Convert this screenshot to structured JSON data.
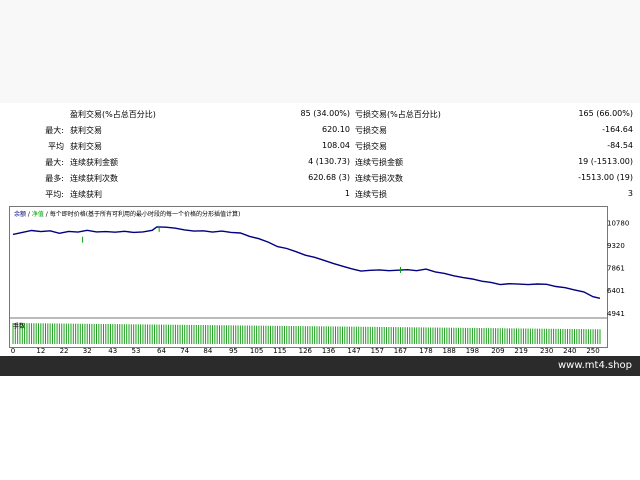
{
  "report": {
    "rows": [
      {
        "left_label": "",
        "left_value": "盈利交易(%占总百分比)",
        "left_num": "85 (34.00%)",
        "right_value": "亏损交易(%占总百分比)",
        "right_num": "165 (66.00%)"
      },
      {
        "left_label": "最大:",
        "left_value": "获利交易",
        "left_num": "620.10",
        "right_value": "亏损交易",
        "right_num": "-164.64"
      },
      {
        "left_label": "平均",
        "left_value": "获利交易",
        "left_num": "108.04",
        "right_value": "亏损交易",
        "right_num": "-84.54"
      },
      {
        "left_label": "最大:",
        "left_value": "连续获利金额",
        "left_num": "4 (130.73)",
        "right_value": "连续亏损金额",
        "right_num": "19 (-1513.00)"
      },
      {
        "left_label": "最多:",
        "left_value": "连续获利次数",
        "left_num": "620.68 (3)",
        "right_value": "连续亏损次数",
        "right_num": "-1513.00 (19)"
      },
      {
        "left_label": "平均:",
        "left_value": "连续获利",
        "left_num": "1",
        "right_value": "连续亏损",
        "right_num": "3"
      }
    ]
  },
  "chart": {
    "legend_balance": "余额",
    "legend_sep": " / ",
    "legend_equity": "净值",
    "legend_text": " / 每个即时价格(基于所有可利用的最小时段的每一个价格的分形插值计算)",
    "volume_label": "手数",
    "colors": {
      "balance": "#000080",
      "equity": "#00a000",
      "volume": "#1aa01a"
    }
  },
  "chart_data": {
    "type": "line",
    "title": "",
    "xlabel": "",
    "ylabel": "",
    "y_ticks": [
      10780,
      9320,
      7861,
      6401,
      4941
    ],
    "x_ticks": [
      0,
      12,
      22,
      32,
      43,
      53,
      64,
      74,
      84,
      95,
      105,
      115,
      126,
      136,
      147,
      157,
      167,
      178,
      188,
      198,
      209,
      219,
      230,
      240,
      250
    ],
    "xlim": [
      0,
      253
    ],
    "ylim": [
      4800,
      11250
    ],
    "series": [
      {
        "values": [
          [
            0,
            10000
          ],
          [
            4,
            10130
          ],
          [
            8,
            10250
          ],
          [
            12,
            10180
          ],
          [
            16,
            10230
          ],
          [
            20,
            10070
          ],
          [
            24,
            10190
          ],
          [
            28,
            10150
          ],
          [
            32,
            10260
          ],
          [
            36,
            10160
          ],
          [
            40,
            10180
          ],
          [
            44,
            10140
          ],
          [
            48,
            10200
          ],
          [
            52,
            10130
          ],
          [
            56,
            10160
          ],
          [
            60,
            10260
          ],
          [
            62,
            10480
          ],
          [
            66,
            10460
          ],
          [
            70,
            10400
          ],
          [
            74,
            10290
          ],
          [
            78,
            10210
          ],
          [
            82,
            10230
          ],
          [
            86,
            10150
          ],
          [
            90,
            10210
          ],
          [
            94,
            10130
          ],
          [
            98,
            10090
          ],
          [
            102,
            9870
          ],
          [
            106,
            9720
          ],
          [
            110,
            9500
          ],
          [
            114,
            9210
          ],
          [
            118,
            9090
          ],
          [
            122,
            8880
          ],
          [
            126,
            8660
          ],
          [
            130,
            8520
          ],
          [
            134,
            8330
          ],
          [
            138,
            8130
          ],
          [
            142,
            7950
          ],
          [
            146,
            7780
          ],
          [
            150,
            7630
          ],
          [
            154,
            7680
          ],
          [
            158,
            7710
          ],
          [
            162,
            7660
          ],
          [
            166,
            7690
          ],
          [
            170,
            7720
          ],
          [
            174,
            7660
          ],
          [
            178,
            7760
          ],
          [
            182,
            7580
          ],
          [
            186,
            7480
          ],
          [
            190,
            7330
          ],
          [
            194,
            7210
          ],
          [
            198,
            7120
          ],
          [
            202,
            6980
          ],
          [
            206,
            6900
          ],
          [
            210,
            6760
          ],
          [
            214,
            6820
          ],
          [
            218,
            6790
          ],
          [
            222,
            6760
          ],
          [
            226,
            6800
          ],
          [
            230,
            6780
          ],
          [
            234,
            6640
          ],
          [
            238,
            6560
          ],
          [
            242,
            6420
          ],
          [
            246,
            6290
          ],
          [
            250,
            5980
          ],
          [
            253,
            5880
          ]
        ]
      }
    ],
    "volume": {
      "start": 5,
      "end": 3.5
    }
  },
  "site": {
    "label": "www.mt4.shop"
  }
}
